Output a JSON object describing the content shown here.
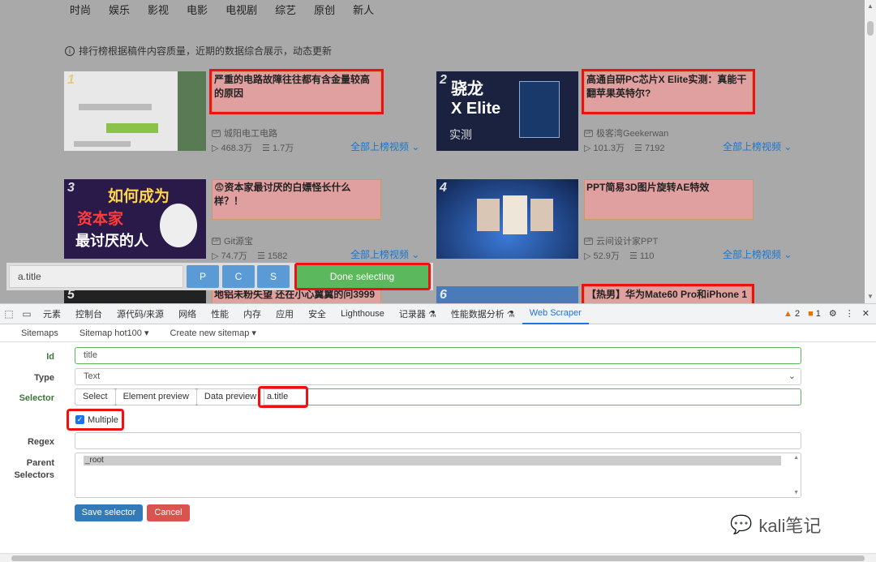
{
  "nav": [
    "时尚",
    "娱乐",
    "影视",
    "电影",
    "电视剧",
    "综艺",
    "原创",
    "新人"
  ],
  "notice": "排行榜根据稿件内容质量，近期的数据综合展示，动态更新",
  "cards": [
    {
      "rank": "1",
      "title": "严重的电路故障往往都有含金量较高的原因",
      "author": "城阳电工电路",
      "views": "468.3万",
      "danmaku": "1.7万",
      "more": "全部上榜视频 ⌄",
      "thumb_text": "",
      "thumb_bg": "#6d8a6a"
    },
    {
      "rank": "2",
      "title": "高通自研PC芯片X Elite实测：真能干翻苹果英特尔?",
      "author": "极客湾Geekerwan",
      "views": "101.3万",
      "danmaku": "7192",
      "more": "全部上榜视频 ⌄",
      "thumb_text": "骁龙 X Elite 实测",
      "thumb_bg": "#1b2240"
    },
    {
      "rank": "3",
      "title": "😨资本家最讨厌的白嫖怪长什么样？！",
      "author": "Git源宝",
      "views": "74.7万",
      "danmaku": "1582",
      "more": "全部上榜视频 ⌄",
      "thumb_text": "如何成为 资本家 最讨厌的人",
      "thumb_bg": "#2a1a4a"
    },
    {
      "rank": "4",
      "title": "PPT简易3D图片旋转AE特效",
      "author": "云间设计家PPT",
      "views": "52.9万",
      "danmaku": "110",
      "more": "全部上榜视频 ⌄",
      "thumb_text": "",
      "thumb_bg": "#1c3470"
    },
    {
      "rank": "5",
      "title": "地铝未粉失望 还在小心翼翼的问3999",
      "author": "",
      "views": "",
      "danmaku": "",
      "more": "",
      "thumb_text": "",
      "thumb_bg": "#222"
    },
    {
      "rank": "6",
      "title": "【热男】华为Mate60 Pro和iPhone 1",
      "author": "",
      "views": "",
      "danmaku": "",
      "more": "",
      "thumb_text": "",
      "thumb_bg": "#4a7ab8"
    }
  ],
  "selector_bar": {
    "value": "a.title",
    "p": "P",
    "c": "C",
    "s": "S",
    "done": "Done selecting"
  },
  "devtools": {
    "tabs": [
      "元素",
      "控制台",
      "源代码/来源",
      "网络",
      "性能",
      "内存",
      "应用",
      "安全",
      "Lighthouse",
      "记录器 ⚗",
      "性能数据分析 ⚗",
      "Web Scraper"
    ],
    "warnings": "2",
    "errors": "1"
  },
  "scraper_nav": {
    "sitemaps": "Sitemaps",
    "sitemap": "Sitemap hot100 ▾",
    "create": "Create new sitemap ▾"
  },
  "form": {
    "id_label": "Id",
    "id_value": "title",
    "type_label": "Type",
    "type_value": "Text",
    "selector_label": "Selector",
    "select_btn": "Select",
    "element_preview": "Element preview",
    "data_preview": "Data preview",
    "selector_value": "a.title",
    "multiple_label": "Multiple",
    "regex_label": "Regex",
    "parent_label1": "Parent",
    "parent_label2": "Selectors",
    "parent_value": "_root",
    "save": "Save selector",
    "cancel": "Cancel"
  },
  "watermark": "kali笔记"
}
